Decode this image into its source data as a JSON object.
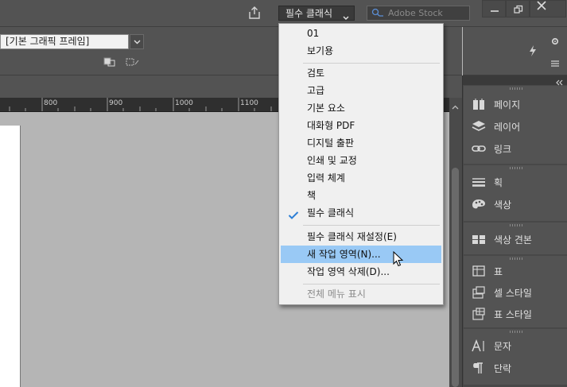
{
  "appbar": {
    "workspace_label": "필수 클래식",
    "stock_placeholder": "Adobe Stock",
    "icons": [
      "share-icon",
      "chevron-down-icon",
      "search-icon",
      "minimize-icon",
      "restore-icon",
      "close-icon"
    ]
  },
  "controlbar": {
    "frame_select_value": "[기본 그래픽 프레임]"
  },
  "ruler": {
    "labels": [
      "800",
      "900",
      "1000",
      "1100"
    ]
  },
  "workspace_menu": {
    "items": [
      {
        "label": "01"
      },
      {
        "label": "보기용"
      },
      {
        "label": "검토"
      },
      {
        "label": "고급"
      },
      {
        "label": "기본 요소"
      },
      {
        "label": "대화형 PDF"
      },
      {
        "label": "디지털 출판"
      },
      {
        "label": "인쇄 및 교정"
      },
      {
        "label": "입력 체계"
      },
      {
        "label": "책"
      },
      {
        "label": "필수 클래식",
        "checked": true
      },
      {
        "label": "필수 클래식 재설정(E)"
      },
      {
        "label": "새 작업 영역(N)...",
        "highlighted": true
      },
      {
        "label": "작업 영역 삭제(D)..."
      },
      {
        "label": "전체 메뉴 표시",
        "disabled": true
      }
    ]
  },
  "panels": {
    "group1": [
      "페이지",
      "레이어",
      "링크"
    ],
    "group2": [
      "획",
      "색상"
    ],
    "group3": [
      "색상 견본"
    ],
    "group4": [
      "표",
      "셀 스타일",
      "표 스타일"
    ],
    "group5": [
      "문자",
      "단락"
    ]
  },
  "colors": {
    "ui_dark": "#535353",
    "menu_bg": "#f0f0f0",
    "menu_highlight": "#99c9f5",
    "check_blue": "#2d7fd6"
  }
}
